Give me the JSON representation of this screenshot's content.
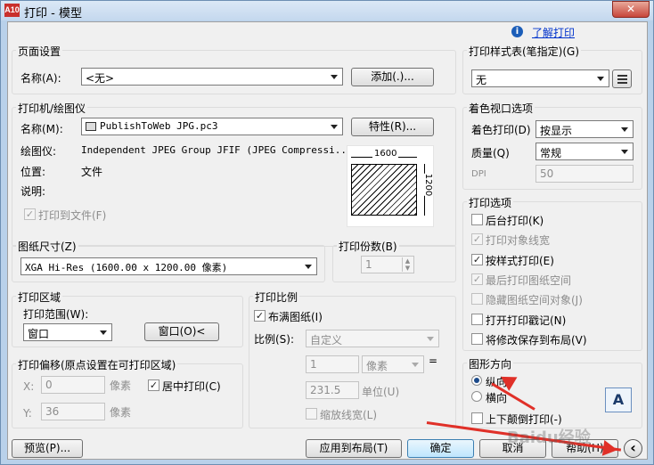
{
  "window": {
    "title": "打印 - 模型",
    "app_icon_text": "A10",
    "close": "✕"
  },
  "help": {
    "icon": "info-icon",
    "link": "了解打印"
  },
  "page_setup": {
    "group": "页面设置",
    "name_label": "名称(A):",
    "name_value": "<无>",
    "add_button": "添加(.)..."
  },
  "plotter": {
    "group": "打印机/绘图仪",
    "name_label": "名称(M):",
    "name_value": "PublishToWeb JPG.pc3",
    "props_button": "特性(R)...",
    "plotter_label": "绘图仪:",
    "plotter_value": "Independent JPEG Group JFIF (JPEG Compressi...",
    "location_label": "位置:",
    "location_value": "文件",
    "desc_label": "说明:",
    "plot_to_file": "打印到文件(F)",
    "preview_width": "1600",
    "preview_height": "1200"
  },
  "paper": {
    "group": "图纸尺寸(Z)",
    "value": "XGA Hi-Res (1600.00 x 1200.00 像素)"
  },
  "copies": {
    "group": "打印份数(B)",
    "value": "1"
  },
  "plot_area": {
    "group": "打印区域",
    "range_label": "打印范围(W):",
    "range_value": "窗口",
    "window_button": "窗口(O)<"
  },
  "plot_offset": {
    "group": "打印偏移(原点设置在可打印区域)",
    "x_label": "X:",
    "x_value": "0",
    "x_unit": "像素",
    "y_label": "Y:",
    "y_value": "36",
    "y_unit": "像素",
    "center": "居中打印(C)"
  },
  "plot_scale": {
    "group": "打印比例",
    "fit": "布满图纸(I)",
    "scale_label": "比例(S):",
    "scale_value": "自定义",
    "num_value": "1",
    "num_unit": "像素",
    "eq": "=",
    "den_value": "231.5",
    "den_unit": "单位(U)",
    "scale_lineweights": "缩放线宽(L)"
  },
  "style_table": {
    "group": "打印样式表(笔指定)(G)",
    "value": "无",
    "edit_icon": "edit-style-icon"
  },
  "shaded": {
    "group": "着色视口选项",
    "shade_label": "着色打印(D)",
    "shade_value": "按显示",
    "quality_label": "质量(Q)",
    "quality_value": "常规",
    "dpi_label": "DPI",
    "dpi_value": "50"
  },
  "options": {
    "group": "打印选项",
    "items": [
      {
        "label": "后台打印(K)",
        "checked": false,
        "enabled": true
      },
      {
        "label": "打印对象线宽",
        "checked": true,
        "enabled": false
      },
      {
        "label": "按样式打印(E)",
        "checked": true,
        "enabled": true
      },
      {
        "label": "最后打印图纸空间",
        "checked": true,
        "enabled": false
      },
      {
        "label": "隐藏图纸空间对象(J)",
        "checked": false,
        "enabled": false
      },
      {
        "label": "打开打印戳记(N)",
        "checked": false,
        "enabled": true
      },
      {
        "label": "将修改保存到布局(V)",
        "checked": false,
        "enabled": true
      }
    ]
  },
  "orientation": {
    "group": "图形方向",
    "portrait": "纵向",
    "landscape": "横向",
    "upside_down": "上下颠倒打印(-)",
    "preview_glyph": "A"
  },
  "bottom": {
    "preview": "预览(P)...",
    "apply": "应用到布局(T)",
    "ok": "确定",
    "cancel": "取消",
    "help": "帮助(H)",
    "collapse": "‹"
  },
  "watermark": "Baidu经验"
}
